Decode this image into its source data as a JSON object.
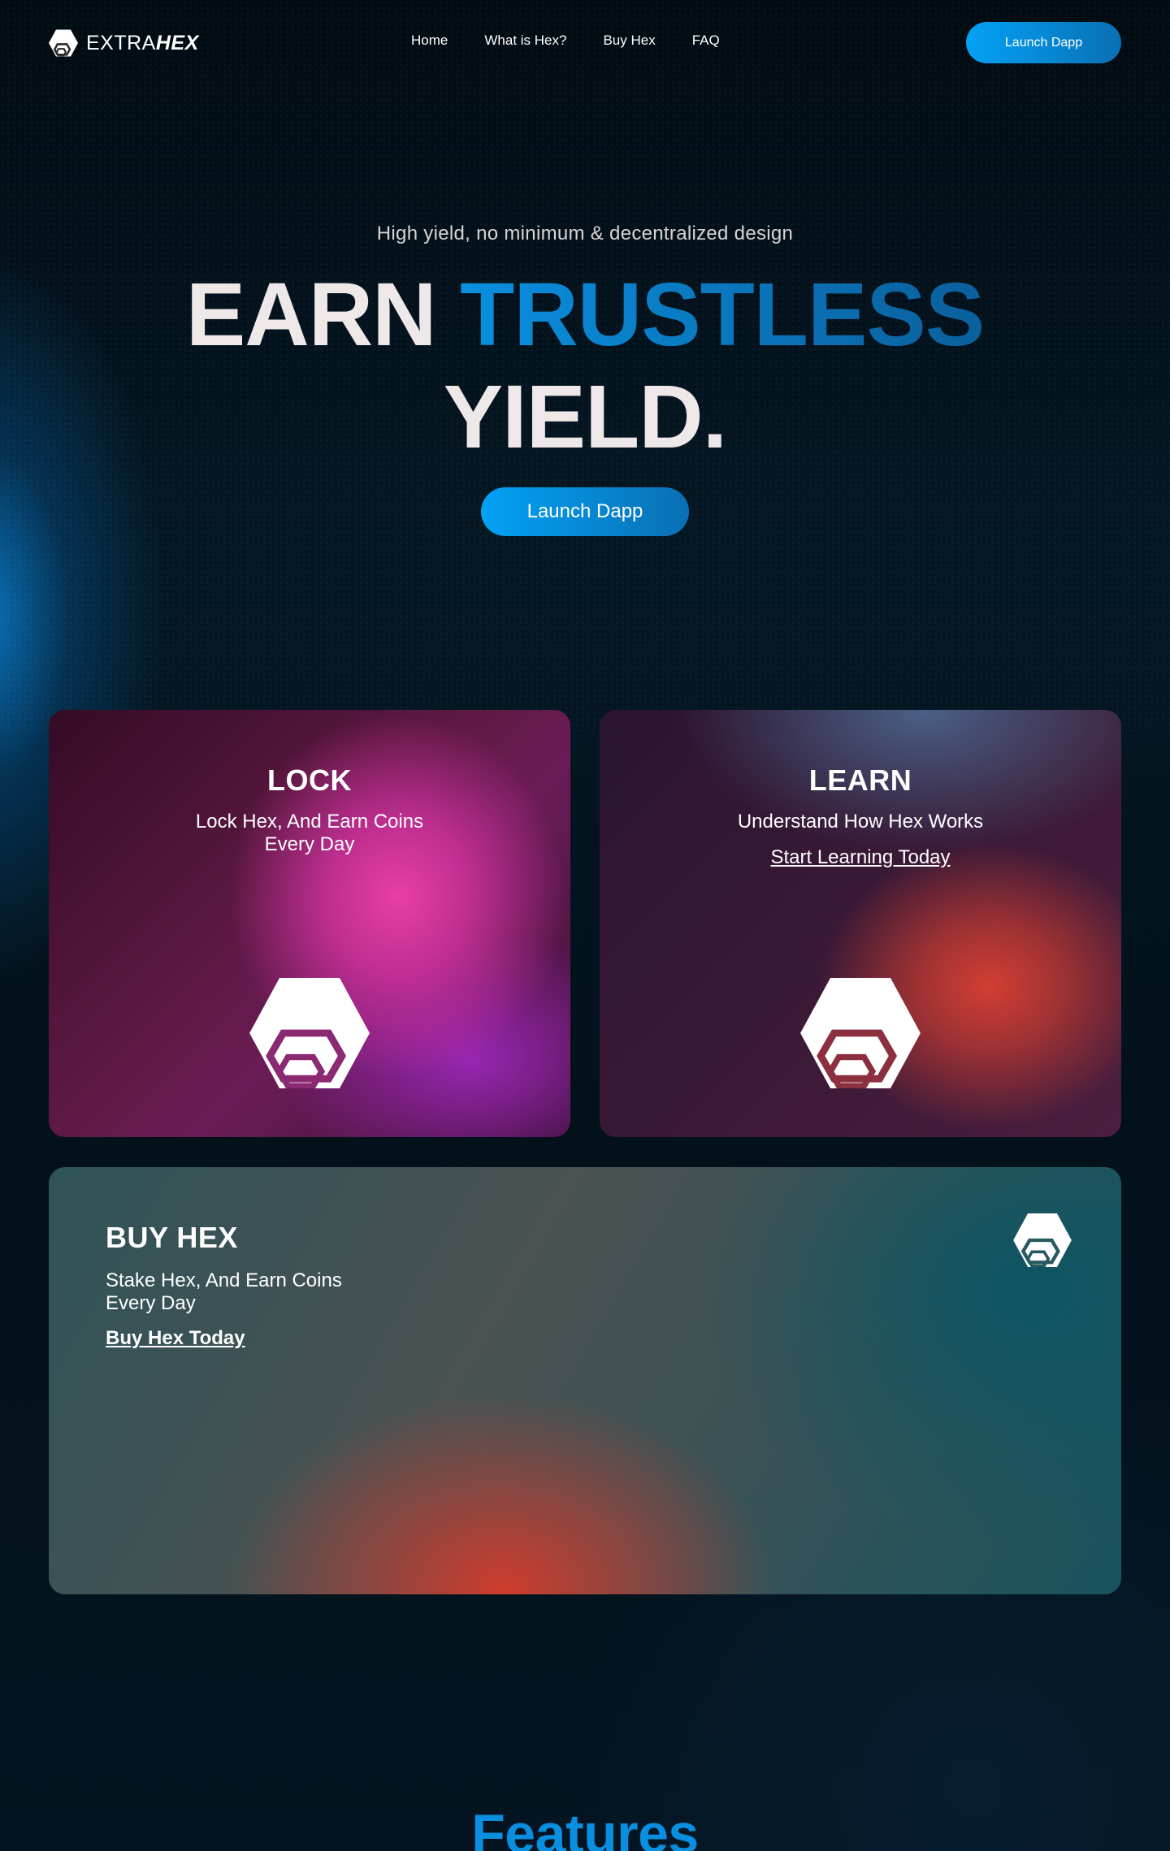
{
  "brand": {
    "name_light": "EXTRA",
    "name_bold": "HEX"
  },
  "nav": {
    "links": [
      "Home",
      "What is Hex?",
      "Buy Hex",
      "FAQ"
    ],
    "cta": "Launch Dapp"
  },
  "hero": {
    "subtitle": "High yield, no minimum & decentralized design",
    "title_word1": "EARN",
    "title_accent": "TRUSTLESS",
    "title_line2": "YIELD.",
    "cta": "Launch Dapp"
  },
  "cards": {
    "lock": {
      "title": "LOCK",
      "text_line1": "Lock Hex, And Earn Coins",
      "text_line2": "Every Day"
    },
    "learn": {
      "title": "LEARN",
      "text": "Understand How Hex Works",
      "link": "Start Learning Today"
    },
    "buy": {
      "title": "BUY HEX",
      "text_line1": "Stake Hex, And Earn Coins",
      "text_line2": "Every Day",
      "link": "Buy Hex Today"
    }
  },
  "features": {
    "title": "Features"
  },
  "icons": {
    "logo": "hex-logo-icon"
  },
  "colors": {
    "accent": "#0596e6",
    "background": "#03121b"
  }
}
